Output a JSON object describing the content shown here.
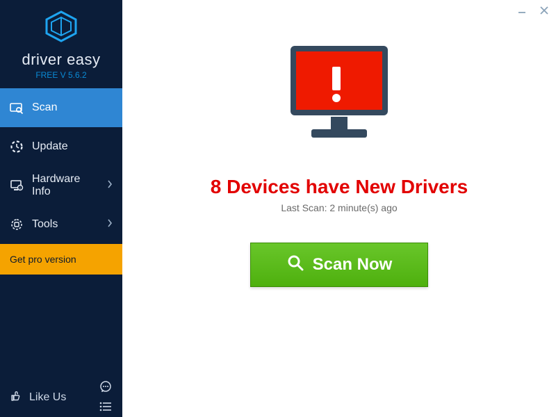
{
  "brand": "driver easy",
  "version_label": "FREE V 5.6.2",
  "sidebar": {
    "items": [
      {
        "label": "Scan",
        "icon": "scan",
        "active": true,
        "has_submenu": false
      },
      {
        "label": "Update",
        "icon": "update",
        "active": false,
        "has_submenu": false
      },
      {
        "label": "Hardware Info",
        "icon": "hardware",
        "active": false,
        "has_submenu": true
      },
      {
        "label": "Tools",
        "icon": "tools",
        "active": false,
        "has_submenu": true
      }
    ],
    "pro_label": "Get pro version",
    "like_label": "Like Us"
  },
  "main": {
    "headline": "8 Devices have New Drivers",
    "last_scan": "Last Scan: 2 minute(s) ago",
    "scan_button_label": "Scan Now"
  },
  "colors": {
    "accent_red": "#e20000",
    "sidebar_bg": "#0b1d39",
    "active_nav": "#2f86d3",
    "pro_bg": "#f5a300",
    "scan_green": "#5abb19"
  }
}
